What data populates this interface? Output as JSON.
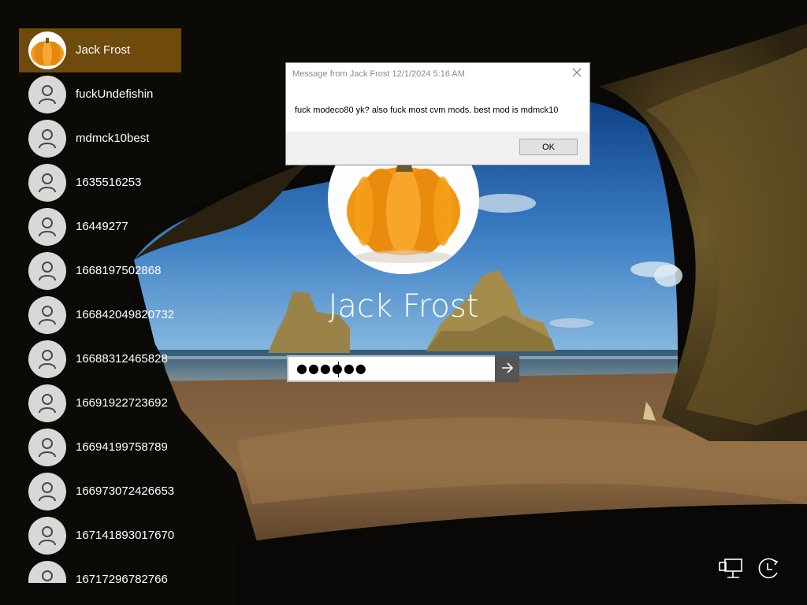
{
  "users": [
    {
      "name": "Jack Frost",
      "avatar": "pumpkin",
      "selected": true
    },
    {
      "name": "fuckUndefishin",
      "avatar": "default-user-icon",
      "selected": false
    },
    {
      "name": "mdmck10best",
      "avatar": "default-user-icon",
      "selected": false
    },
    {
      "name": "1635516253",
      "avatar": "default-user-icon",
      "selected": false
    },
    {
      "name": "16449277",
      "avatar": "default-user-icon",
      "selected": false
    },
    {
      "name": "1668197502868",
      "avatar": "default-user-icon",
      "selected": false
    },
    {
      "name": "166842049820732",
      "avatar": "default-user-icon",
      "selected": false
    },
    {
      "name": "16688312465828",
      "avatar": "default-user-icon",
      "selected": false
    },
    {
      "name": "16691922723692",
      "avatar": "default-user-icon",
      "selected": false
    },
    {
      "name": "16694199758789",
      "avatar": "default-user-icon",
      "selected": false
    },
    {
      "name": "166973072426653",
      "avatar": "default-user-icon",
      "selected": false
    },
    {
      "name": "167141893017670",
      "avatar": "default-user-icon",
      "selected": false
    },
    {
      "name": "16717296782766",
      "avatar": "default-user-icon",
      "selected": false
    }
  ],
  "signin": {
    "display_name": "Jack Frost",
    "password_mask": "●●●●●●",
    "submit_icon": "arrow-right-icon"
  },
  "message_box": {
    "title": "Message from Jack Frost 12/1/2024 5:16 AM",
    "body": "fuck modeco80 yk? also fuck most cvm mods. best mod is mdmck10",
    "ok_label": "OK",
    "close_icon": "close-icon"
  },
  "system_icons": {
    "network": "network-icon",
    "ease_of_access": "ease-of-access-icon"
  },
  "colors": {
    "selected_user_bg": "#6e4a0c",
    "submit_button_bg": "#555555"
  }
}
